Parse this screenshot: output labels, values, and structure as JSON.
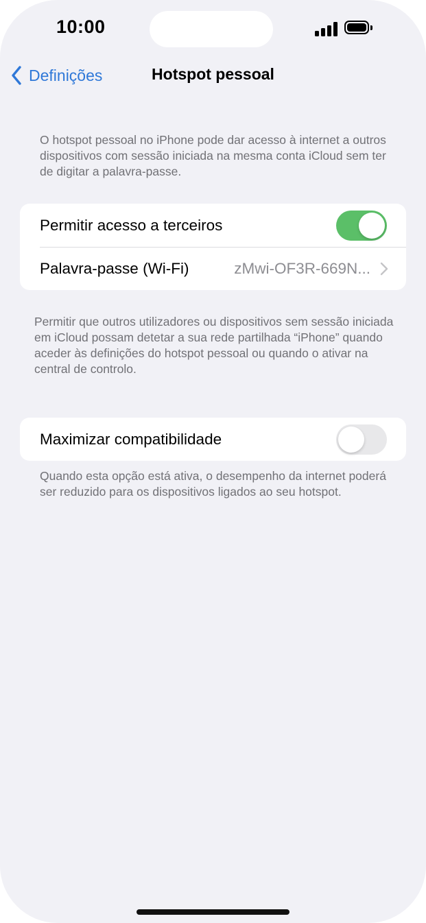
{
  "status_bar": {
    "time": "10:00"
  },
  "nav": {
    "back_label": "Definições",
    "back_icon": "chevron-left-icon",
    "title": "Hotspot pessoal"
  },
  "intro_text": "O hotspot pessoal no iPhone pode dar acesso à internet a outros dispositivos com sessão iniciada na mesma conta iCloud sem ter de digitar a palavra-passe.",
  "section1": {
    "allow_others": {
      "label": "Permitir acesso a terceiros",
      "toggle_on": true
    },
    "password": {
      "label": "Palavra-passe (Wi-Fi)",
      "value": "zMwi-OF3R-669N...",
      "icon": "chevron-right-icon"
    },
    "footer": "Permitir que outros utilizadores ou dispositivos sem sessão iniciada em iCloud possam detetar a sua rede partilhada “iPhone” quando aceder às definições do hotspot pessoal ou quando o ativar na central de controlo."
  },
  "section2": {
    "maximize": {
      "label": "Maximizar compatibilidade",
      "toggle_on": false
    },
    "footer": "Quando esta opção está ativa, o desempenho da internet poderá ser reduzido para os dispositivos ligados ao seu hotspot."
  },
  "colors": {
    "accent": "#2f78d8",
    "toggle_on": "#5bbf68",
    "background": "#f1f1f6"
  }
}
